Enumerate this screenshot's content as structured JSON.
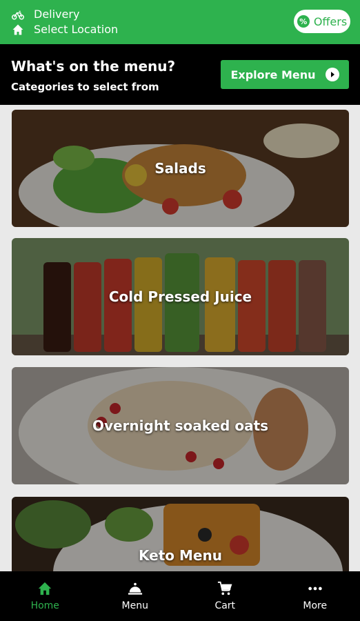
{
  "header": {
    "delivery_label": "Delivery",
    "location_label": "Select Location",
    "offers_label": "Offers",
    "offers_icon_glyph": "%",
    "brand_color": "#2eb24e"
  },
  "menu_header": {
    "title": "What's on the menu?",
    "subtitle": "Categories to select from",
    "explore_label": "Explore Menu"
  },
  "categories": [
    {
      "label": "Salads"
    },
    {
      "label": "Cold Pressed Juice"
    },
    {
      "label": "Overnight soaked oats"
    },
    {
      "label": "Keto Menu"
    }
  ],
  "bottom_nav": [
    {
      "label": "Home",
      "icon": "home-icon",
      "active": true
    },
    {
      "label": "Menu",
      "icon": "cloche-icon",
      "active": false
    },
    {
      "label": "Cart",
      "icon": "cart-icon",
      "active": false
    },
    {
      "label": "More",
      "icon": "more-dots-icon",
      "active": false
    }
  ]
}
